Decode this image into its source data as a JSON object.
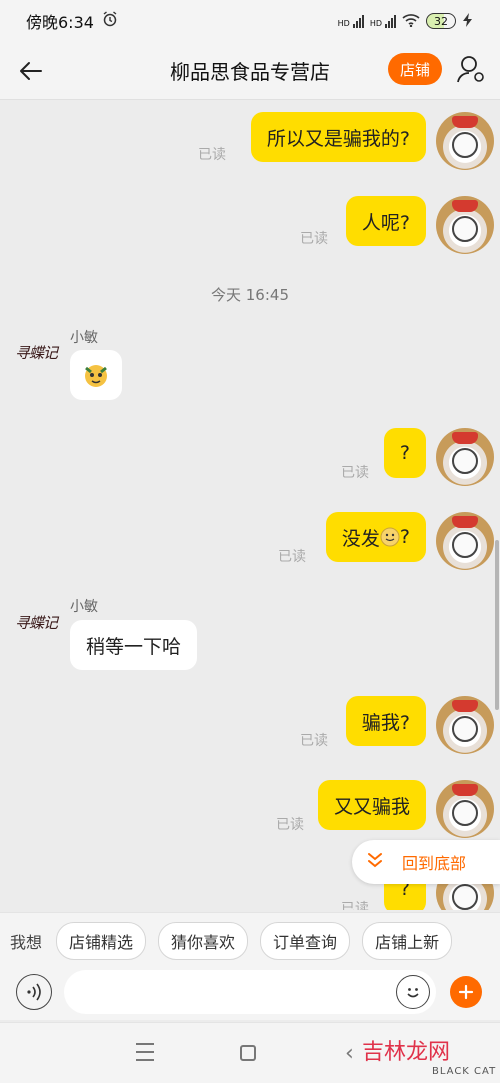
{
  "status": {
    "time": "傍晚6:34",
    "network1": "HD",
    "network2": "HD",
    "battery": "32"
  },
  "header": {
    "title": "柳品思食品专营店",
    "store_label": "店铺"
  },
  "messages": {
    "m1": {
      "text": "所以又是骗我的?",
      "read": "已读"
    },
    "m2": {
      "text": "人呢?",
      "read": "已读"
    },
    "time_divider": "今天  16:45",
    "shop_name_1": "小敏",
    "shop_logo_text": "寻蝶记",
    "m4": {
      "text": "?",
      "read": "已读"
    },
    "m5": {
      "text_before": "没发",
      "text_after": "?",
      "read": "已读"
    },
    "shop_name_2": "小敏",
    "m6": {
      "text": "稍等一下哈"
    },
    "m7": {
      "text": "骗我?",
      "read": "已读"
    },
    "m8": {
      "text": "又又骗我",
      "read": "已读"
    },
    "m9": {
      "text": "?",
      "read": "已读"
    }
  },
  "back_to_bottom": "回到底部",
  "quickbar": {
    "label": "我想",
    "chips": [
      "店铺精选",
      "猜你喜欢",
      "订单查询",
      "店铺上新"
    ]
  },
  "input": {
    "placeholder": ""
  },
  "watermark": {
    "text": "吉林龙网",
    "sub": "BLACK CAT"
  },
  "colors": {
    "accent": "#ff6a00",
    "bubble_out": "#ffdd00",
    "bubble_in": "#ffffff"
  }
}
